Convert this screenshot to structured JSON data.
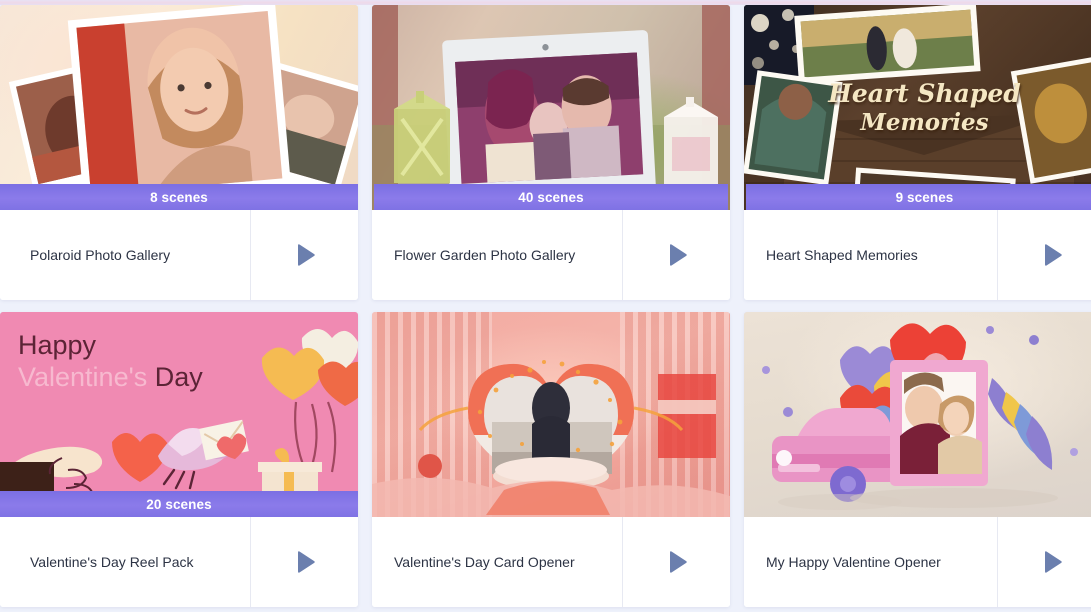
{
  "page": {
    "background_color": "#eef1fb",
    "badge_color": "#7f72e4",
    "play_icon_color": "#6b7fae",
    "title_text_color": "#2c3344"
  },
  "cards": [
    {
      "id": "polaroid-photo-gallery",
      "title": "Polaroid Photo Gallery",
      "scenes_label": "8 scenes",
      "scene_count": 8,
      "has_badge": true,
      "badge_inset": false,
      "play_icon": "play-icon",
      "thumbnail": "polaroid photos of people scattered on a warm cream surface"
    },
    {
      "id": "flower-garden-photo-gallery",
      "title": "Flower Garden Photo Gallery",
      "scenes_label": "40 scenes",
      "scene_count": 40,
      "has_badge": true,
      "badge_inset": true,
      "play_icon": "play-icon",
      "thumbnail": "white picture frame of a family kissing a baby between two lanterns"
    },
    {
      "id": "heart-shaped-memories",
      "title": "Heart Shaped Memories",
      "scenes_label": "9 scenes",
      "scene_count": 9,
      "has_badge": true,
      "badge_inset": true,
      "play_icon": "play-icon",
      "thumbnail_title_line1": "Heart Shaped",
      "thumbnail_title_line2": "Memories",
      "thumbnail": "gold script title on dark wood with tilted photo prints"
    },
    {
      "id": "valentines-day-reel-pack",
      "title": "Valentine's Day Reel Pack",
      "scenes_label": "20 scenes",
      "scene_count": 20,
      "has_badge": true,
      "badge_inset": false,
      "play_icon": "play-icon",
      "thumbnail_heading_line1": "Happy",
      "thumbnail_heading_line2_faint": "Valentine's",
      "thumbnail_heading_line2_bold": "Day",
      "thumbnail": "flat pink illustration with balloons, dove carrying a letter and a hand"
    },
    {
      "id": "valentines-day-card-opener",
      "title": "Valentine's Day Card Opener",
      "scenes_label": "",
      "scene_count": null,
      "has_badge": false,
      "badge_inset": false,
      "play_icon": "play-icon",
      "thumbnail": "3d pink stage with glittering heart frame and a couple silhouette"
    },
    {
      "id": "my-happy-valentine-opener",
      "title": "My Happy Valentine Opener",
      "scenes_label": "",
      "scene_count": null,
      "has_badge": false,
      "badge_inset": false,
      "play_icon": "play-icon",
      "thumbnail": "3d pink car and photo frame of a couple with floating hearts"
    }
  ]
}
